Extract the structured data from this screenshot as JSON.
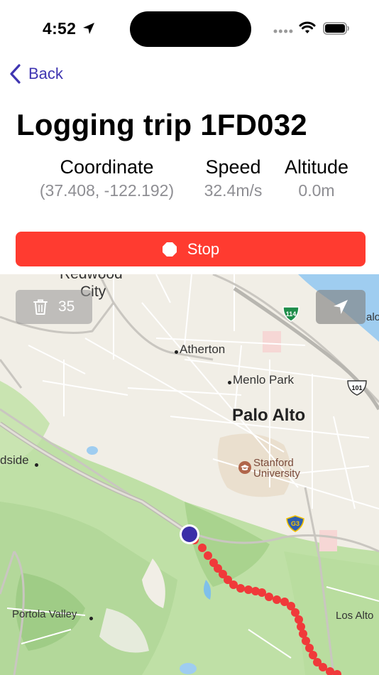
{
  "status_bar": {
    "time": "4:52"
  },
  "nav": {
    "back_label": "Back"
  },
  "page": {
    "title": "Logging trip 1FD032"
  },
  "stats": {
    "coordinate": {
      "label": "Coordinate",
      "value": "(37.408, -122.192)"
    },
    "speed": {
      "label": "Speed",
      "value": "32.4m/s"
    },
    "altitude": {
      "label": "Altitude",
      "value": "0.0m"
    }
  },
  "actions": {
    "stop_label": "Stop",
    "point_count": "35"
  },
  "map": {
    "labels": {
      "redwood_1": "Redwood",
      "redwood_2": "City",
      "atherton": "Atherton",
      "menlo_park": "Menlo Park",
      "palo_alto": "Palo Alto",
      "stanford_1": "Stanford",
      "stanford_2": "University",
      "woodside": "dside",
      "portola_valley": "Portola Valley",
      "los_altos": "Los Alto",
      "palo_edge": "alo",
      "hwy_114": "114",
      "hwy_101": "101",
      "hwy_g3": "G3"
    },
    "colors": {
      "track": "#f03a3a",
      "current_location": "#3b2fa8",
      "stop_button": "#ff3b30",
      "accent": "#3f35b1"
    }
  }
}
